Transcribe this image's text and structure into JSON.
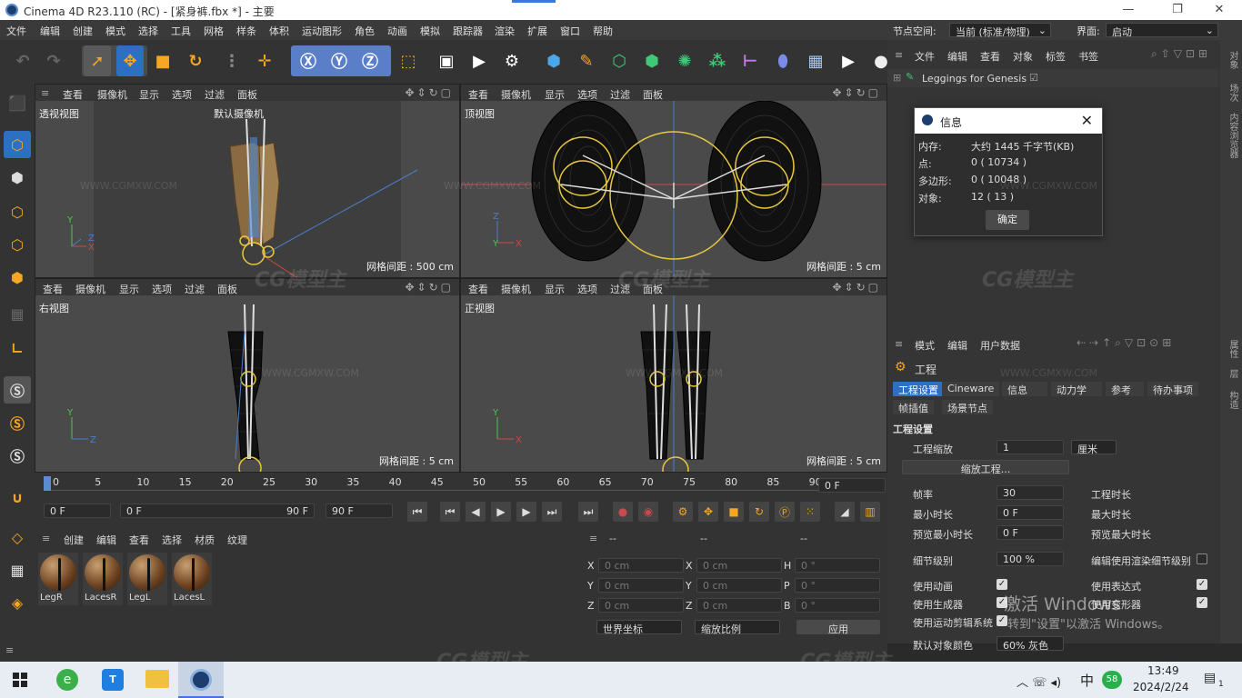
{
  "window": {
    "title": "Cinema 4D R23.110 (RC) - [紧身裤.fbx *] - 主要",
    "minimize": "—",
    "maximize": "❐",
    "close": "✕"
  },
  "menu": [
    "文件",
    "编辑",
    "创建",
    "模式",
    "选择",
    "工具",
    "网格",
    "样条",
    "体积",
    "运动图形",
    "角色",
    "动画",
    "模拟",
    "跟踪器",
    "渲染",
    "扩展",
    "窗口",
    "帮助"
  ],
  "node_space": {
    "label": "节点空间:",
    "value": "当前 (标准/物理)"
  },
  "layout": {
    "label": "界面:",
    "value": "启动"
  },
  "viewport_menu": [
    "查看",
    "摄像机",
    "显示",
    "选项",
    "过滤",
    "面板"
  ],
  "viewports": {
    "perspective": {
      "label": "透视视图",
      "camera": "默认摄像机",
      "grid": "网格间距 : 500 cm"
    },
    "top": {
      "label": "顶视图",
      "grid": "网格间距 : 5 cm"
    },
    "right": {
      "label": "右视图",
      "grid": "网格间距 : 5 cm"
    },
    "front": {
      "label": "正视图",
      "grid": "网格间距 : 5 cm"
    }
  },
  "info_dialog": {
    "title": "信息",
    "rows": [
      {
        "label": "内存:",
        "value": "大约 1445 千字节(KB)"
      },
      {
        "label": "点:",
        "value": "0 ( 10734 )"
      },
      {
        "label": "多边形:",
        "value": "0 ( 10048 )"
      },
      {
        "label": "对象:",
        "value": "12 ( 13 )"
      }
    ],
    "ok": "确定"
  },
  "object_manager": {
    "menu": [
      "文件",
      "编辑",
      "查看",
      "对象",
      "标签",
      "书签"
    ],
    "object": "Leggings for Genesis"
  },
  "attr_manager": {
    "menu": [
      "模式",
      "编辑",
      "用户数据"
    ],
    "section": "工程",
    "tabs_row1": [
      "工程设置",
      "Cineware",
      "信息",
      "动力学",
      "参考",
      "待办事项"
    ],
    "tabs_row2": [
      "帧插值",
      "场景节点"
    ],
    "group": "工程设置",
    "scale_label": "工程缩放",
    "scale_value": "1",
    "scale_unit": "厘米",
    "scale_btn": "缩放工程...",
    "fps_label": "帧率",
    "fps_value": "30",
    "proj_len_label": "工程时长",
    "min_time_label": "最小时长",
    "min_time_value": "0 F",
    "max_time_label": "最大时长",
    "preview_min_label": "预览最小时长",
    "preview_min_value": "0 F",
    "preview_max_label": "预览最大时长",
    "lod_label": "细节级别",
    "lod_value": "100 %",
    "render_lod_label": "编辑使用渲染细节级别",
    "use_anim": "使用动画",
    "use_expr": "使用表达式",
    "use_gen": "使用生成器",
    "use_deform": "使用变形器",
    "use_motion": "使用运动剪辑系统",
    "default_color_label": "默认对象颜色",
    "default_color_value": "60% 灰色"
  },
  "side_tabs": [
    "对象",
    "场次",
    "内容浏览器",
    "层"
  ],
  "side_tabs2": [
    "属性",
    "层",
    "构造"
  ],
  "timeline": {
    "ticks": [
      "0",
      "5",
      "10",
      "15",
      "20",
      "25",
      "30",
      "35",
      "40",
      "45",
      "50",
      "55",
      "60",
      "65",
      "70",
      "75",
      "80",
      "85",
      "90"
    ],
    "current": "0 F",
    "start": "0 F",
    "range_start": "0 F",
    "range_end": "90 F",
    "end": "90 F"
  },
  "materials": {
    "menu": [
      "创建",
      "编辑",
      "查看",
      "选择",
      "材质",
      "纹理"
    ],
    "items": [
      "LegR",
      "LacesR",
      "LegL",
      "LacesL"
    ]
  },
  "coords": {
    "headers": [
      "--",
      "--",
      "--"
    ],
    "rows": [
      {
        "a": "X",
        "av": "0 cm",
        "b": "X",
        "bv": "0 cm",
        "c": "H",
        "cv": "0 °"
      },
      {
        "a": "Y",
        "av": "0 cm",
        "b": "Y",
        "bv": "0 cm",
        "c": "P",
        "cv": "0 °"
      },
      {
        "a": "Z",
        "av": "0 cm",
        "b": "Z",
        "bv": "0 cm",
        "c": "B",
        "cv": "0 °"
      }
    ],
    "world": "世界坐标",
    "scale": "缩放比例",
    "apply": "应用"
  },
  "activation": {
    "line1": "激活 Windows",
    "line2": "转到\"设置\"以激活 Windows。"
  },
  "watermark": {
    "logo": "CG模型主",
    "url": "WWW.CGMXW.COM"
  },
  "taskbar": {
    "time": "13:49",
    "date": "2024/2/24",
    "ime": "中",
    "badge": "58",
    "notif": "1"
  },
  "colors": {
    "accent": "#f5a623",
    "selection": "#2d6fc0",
    "yellow_rig": "#e8c840"
  }
}
